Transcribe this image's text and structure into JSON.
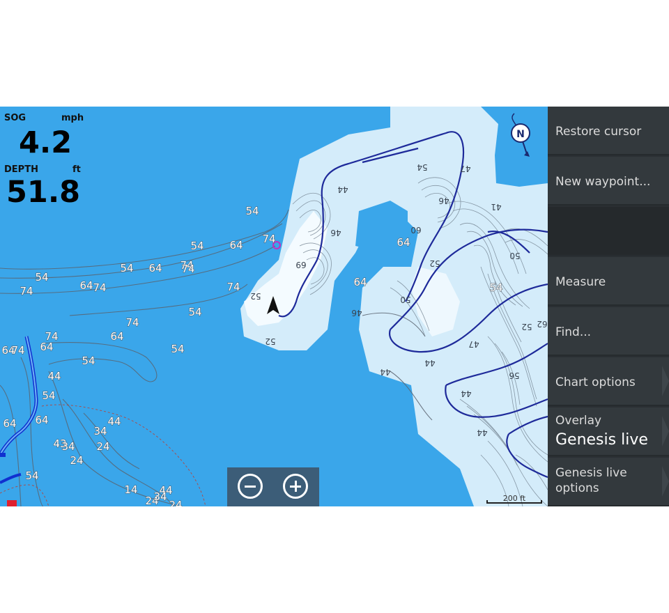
{
  "data_overlay": {
    "sog_label": "SOG",
    "sog_unit": "mph",
    "sog_value": "4.2",
    "depth_label": "DEPTH",
    "depth_unit": "ft",
    "depth_value": "51.8"
  },
  "map": {
    "scale_label": "200 ft",
    "north_label": "N",
    "colors": {
      "deep_water": "#3aa6ea",
      "shallow_water": "#d4ecfa",
      "very_shallow": "#f4fbff",
      "contour_line": "#5a6470",
      "depth_highlight_line": "#1e2a9a"
    },
    "depth_labels": [
      "54",
      "74",
      "54",
      "64",
      "74",
      "54",
      "74",
      "54",
      "64",
      "74",
      "74",
      "64",
      "74",
      "64",
      "54",
      "64",
      "74",
      "64",
      "54",
      "74",
      "64",
      "74",
      "44",
      "54",
      "64",
      "54",
      "44",
      "64",
      "34",
      "43",
      "34",
      "24",
      "24",
      "54",
      "14",
      "24",
      "44",
      "34",
      "24",
      "52",
      "52",
      "69",
      "46",
      "44",
      "60",
      "64",
      "54",
      "46",
      "52",
      "50",
      "50",
      "44",
      "44",
      "47",
      "41",
      "56",
      "44",
      "52",
      "44",
      "46",
      "47",
      "62",
      "54"
    ]
  },
  "zoom": {
    "zoom_out_icon": "minus-circle-icon",
    "zoom_in_icon": "plus-circle-icon"
  },
  "menu": {
    "items": [
      {
        "label": "Restore cursor"
      },
      {
        "label": "New waypoint..."
      },
      {
        "label": ""
      },
      {
        "label": "Measure"
      },
      {
        "label": "Find..."
      },
      {
        "label": "Chart options"
      },
      {
        "sub": "Overlay",
        "big": "Genesis live"
      },
      {
        "label": "Genesis live options"
      }
    ]
  }
}
